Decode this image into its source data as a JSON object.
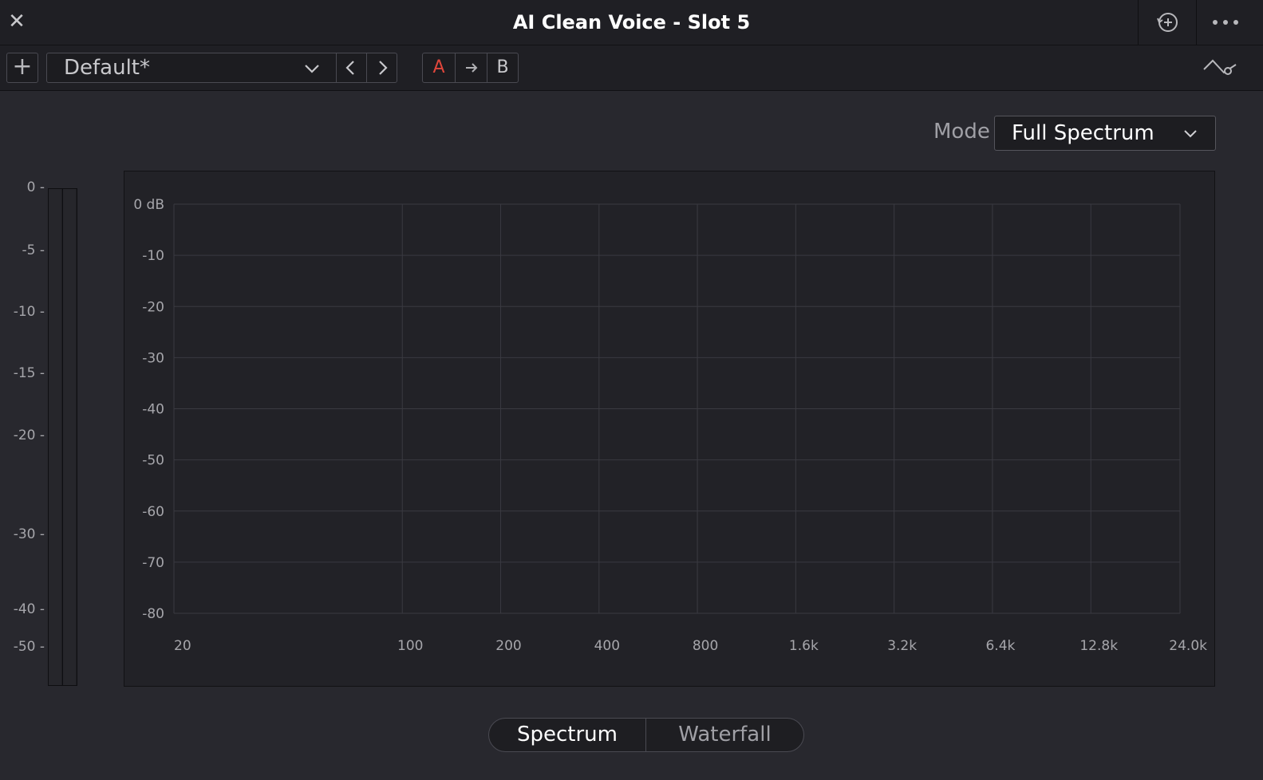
{
  "window": {
    "title": "AI Clean Voice - Slot 5",
    "close_icon": "close-icon",
    "history_icon": "history-icon",
    "more_icon": "more-icon"
  },
  "toolbar": {
    "add_label": "+",
    "preset_name": "Default*",
    "ab": {
      "a_label": "A",
      "b_label": "B",
      "a_color": "#e0463b"
    }
  },
  "mode": {
    "label": "Mode",
    "value": "Full Spectrum"
  },
  "meter": {
    "ticks": [
      "0 -",
      "-5 -",
      "-10 -",
      "-15 -",
      "-20 -",
      "-30 -",
      "-40 -",
      "-50 -"
    ]
  },
  "chart_data": {
    "type": "line",
    "series": [],
    "y_ticks": [
      "0 dB",
      "-10",
      "-20",
      "-30",
      "-40",
      "-50",
      "-60",
      "-70",
      "-80"
    ],
    "x_ticks": [
      "20",
      "100",
      "200",
      "400",
      "800",
      "1.6k",
      "3.2k",
      "6.4k",
      "12.8k",
      "24.0k"
    ],
    "ylim": [
      -80,
      0
    ],
    "xlim": [
      20,
      24000
    ],
    "x_scale": "log",
    "grid": true
  },
  "view": {
    "spectrum_label": "Spectrum",
    "waterfall_label": "Waterfall",
    "selected": "Spectrum"
  }
}
